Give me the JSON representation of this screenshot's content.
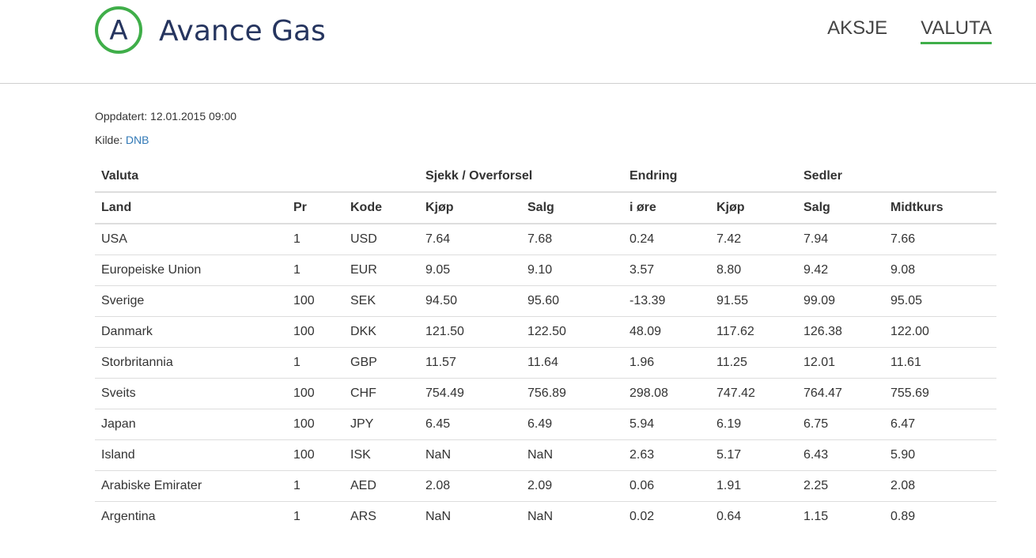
{
  "brand": {
    "logo_letter": "A",
    "name": "Avance Gas",
    "mark_color": "#3fae49",
    "text_color": "#26355f"
  },
  "nav": {
    "items": [
      {
        "label": "AKSJE",
        "active": false
      },
      {
        "label": "VALUTA",
        "active": true
      }
    ]
  },
  "meta": {
    "updated": "Oppdatert: 12.01.2015 09:00",
    "source_label": "Kilde:",
    "source_link": "DNB",
    "link_color": "#337ab7"
  },
  "table": {
    "group_headers": {
      "valuta": "Valuta",
      "sjekk": "Sjekk / Overforsel",
      "endring": "Endring",
      "sedler": "Sedler"
    },
    "columns": [
      "Land",
      "Pr",
      "Kode",
      "Kjøp",
      "Salg",
      "i øre",
      "Kjøp",
      "Salg",
      "Midtkurs"
    ],
    "rows": [
      [
        "USA",
        "1",
        "USD",
        "7.64",
        "7.68",
        "0.24",
        "7.42",
        "7.94",
        "7.66"
      ],
      [
        "Europeiske Union",
        "1",
        "EUR",
        "9.05",
        "9.10",
        "3.57",
        "8.80",
        "9.42",
        "9.08"
      ],
      [
        "Sverige",
        "100",
        "SEK",
        "94.50",
        "95.60",
        "-13.39",
        "91.55",
        "99.09",
        "95.05"
      ],
      [
        "Danmark",
        "100",
        "DKK",
        "121.50",
        "122.50",
        "48.09",
        "117.62",
        "126.38",
        "122.00"
      ],
      [
        "Storbritannia",
        "1",
        "GBP",
        "11.57",
        "11.64",
        "1.96",
        "11.25",
        "12.01",
        "11.61"
      ],
      [
        "Sveits",
        "100",
        "CHF",
        "754.49",
        "756.89",
        "298.08",
        "747.42",
        "764.47",
        "755.69"
      ],
      [
        "Japan",
        "100",
        "JPY",
        "6.45",
        "6.49",
        "5.94",
        "6.19",
        "6.75",
        "6.47"
      ],
      [
        "Island",
        "100",
        "ISK",
        "NaN",
        "NaN",
        "2.63",
        "5.17",
        "6.43",
        "5.90"
      ],
      [
        "Arabiske Emirater",
        "1",
        "AED",
        "2.08",
        "2.09",
        "0.06",
        "1.91",
        "2.25",
        "2.08"
      ],
      [
        "Argentina",
        "1",
        "ARS",
        "NaN",
        "NaN",
        "0.02",
        "0.64",
        "1.15",
        "0.89"
      ]
    ]
  }
}
